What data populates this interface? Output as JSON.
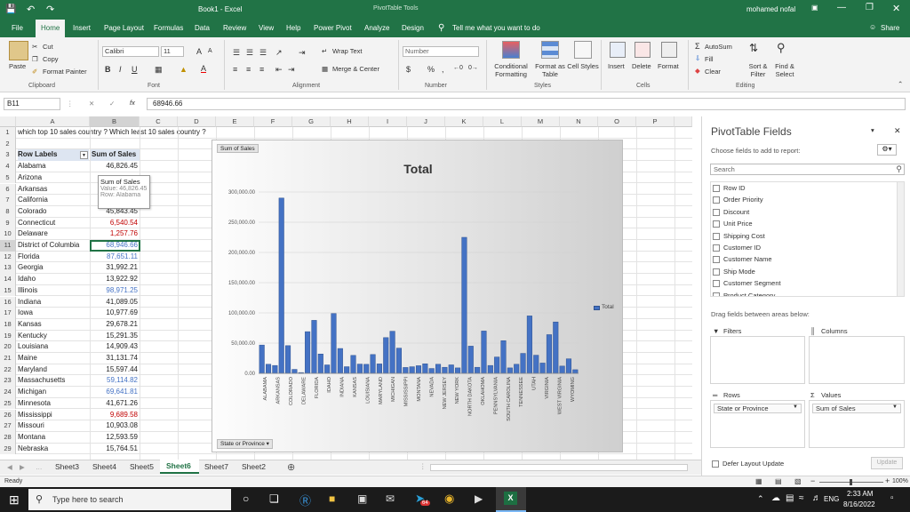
{
  "app": {
    "window_title": "Book1 - Excel",
    "contextual": "PivotTable Tools",
    "user": "mohamed nofal",
    "share": "Share"
  },
  "tabs": [
    "File",
    "Home",
    "Insert",
    "Page Layout",
    "Formulas",
    "Data",
    "Review",
    "View",
    "Help",
    "Power Pivot",
    "Analyze",
    "Design"
  ],
  "tell_me": "Tell me what you want to do",
  "ribbon": {
    "clipboard": {
      "paste": "Paste",
      "cut": "Cut",
      "copy": "Copy",
      "format_painter": "Format Painter",
      "label": "Clipboard"
    },
    "font": {
      "name": "Calibri",
      "size": "11",
      "bold": "B",
      "italic": "I",
      "underline": "U",
      "grow": "A",
      "shrink": "A",
      "label": "Font"
    },
    "alignment": {
      "wrap": "Wrap Text",
      "merge": "Merge & Center",
      "label": "Alignment"
    },
    "number": {
      "format": "Number",
      "currency": "$",
      "percent": "%",
      "comma": ",",
      "label": "Number"
    },
    "styles": {
      "cond": "Conditional Formatting",
      "table": "Format as Table",
      "cell": "Cell Styles",
      "label": "Styles"
    },
    "cells": {
      "insert": "Insert",
      "delete": "Delete",
      "format": "Format",
      "label": "Cells"
    },
    "editing": {
      "autosum": "AutoSum",
      "fill": "Fill",
      "clear": "Clear",
      "sort": "Sort & Filter",
      "find": "Find & Select",
      "label": "Editing"
    }
  },
  "formula_bar": {
    "name_box": "B11",
    "fx": "fx",
    "value": "68946.66"
  },
  "columns": [
    "A",
    "B",
    "C",
    "D",
    "E",
    "F",
    "G",
    "H",
    "I",
    "J",
    "K",
    "L",
    "M",
    "N",
    "O",
    "P"
  ],
  "question": "which top 10 sales country ? Which least 10 sales country ?",
  "pivot_headers": {
    "row_labels": "Row Labels",
    "sum": "Sum of Sales"
  },
  "rows": [
    {
      "n": "1"
    },
    {
      "n": "2"
    },
    {
      "n": "3",
      "a": "Row Labels",
      "b": "Sum of Sales"
    },
    {
      "n": "4",
      "a": "Alabama",
      "b": "46,826.45"
    },
    {
      "n": "5",
      "a": "Arizona",
      "b": ""
    },
    {
      "n": "6",
      "a": "Arkansas",
      "b": ""
    },
    {
      "n": "7",
      "a": "California",
      "b": ""
    },
    {
      "n": "8",
      "a": "Colorado",
      "b": "45,843.45"
    },
    {
      "n": "9",
      "a": "Connecticut",
      "b": "6,540.54",
      "c": "#c00000"
    },
    {
      "n": "10",
      "a": "Delaware",
      "b": "1,257.76",
      "c": "#c00000"
    },
    {
      "n": "11",
      "a": "District of Columbia",
      "b": "68,946.66",
      "c": "#4472c4"
    },
    {
      "n": "12",
      "a": "Florida",
      "b": "87,651.11",
      "c": "#4472c4"
    },
    {
      "n": "13",
      "a": "Georgia",
      "b": "31,992.21"
    },
    {
      "n": "14",
      "a": "Idaho",
      "b": "13,922.92"
    },
    {
      "n": "15",
      "a": "Illinois",
      "b": "98,971.25",
      "c": "#4472c4"
    },
    {
      "n": "16",
      "a": "Indiana",
      "b": "41,089.05"
    },
    {
      "n": "17",
      "a": "Iowa",
      "b": "10,977.69"
    },
    {
      "n": "18",
      "a": "Kansas",
      "b": "29,678.21"
    },
    {
      "n": "19",
      "a": "Kentucky",
      "b": "15,291.35"
    },
    {
      "n": "20",
      "a": "Louisiana",
      "b": "14,909.43"
    },
    {
      "n": "21",
      "a": "Maine",
      "b": "31,131.74"
    },
    {
      "n": "22",
      "a": "Maryland",
      "b": "15,597.44"
    },
    {
      "n": "23",
      "a": "Massachusetts",
      "b": "59,114.82",
      "c": "#4472c4"
    },
    {
      "n": "24",
      "a": "Michigan",
      "b": "69,641.81",
      "c": "#4472c4"
    },
    {
      "n": "25",
      "a": "Minnesota",
      "b": "41,671.26"
    },
    {
      "n": "26",
      "a": "Mississippi",
      "b": "9,689.58",
      "c": "#c00000"
    },
    {
      "n": "27",
      "a": "Missouri",
      "b": "10,903.08"
    },
    {
      "n": "28",
      "a": "Montana",
      "b": "12,593.59"
    },
    {
      "n": "29",
      "a": "Nebraska",
      "b": "15,764.51"
    }
  ],
  "tooltip": {
    "title": "Sum of Sales",
    "value": "Value: 46,826.45",
    "row": "Row: Alabama"
  },
  "chart_data": {
    "type": "bar",
    "title": "Total",
    "field_button": "Sum of Sales",
    "axis_button": "State or Province",
    "legend": "Total",
    "legend_position": "right",
    "ylim": [
      0,
      300000
    ],
    "yticks": [
      "0.00",
      "50,000.00",
      "100,000.00",
      "150,000.00",
      "200,000.00",
      "250,000.00",
      "300,000.00"
    ],
    "grid": true,
    "categories": [
      "ALABAMA",
      "ARKANSAS",
      "COLORADO",
      "DELAWARE",
      "FLORIDA",
      "IDAHO",
      "INDIANA",
      "KANSAS",
      "LOUISIANA",
      "MARYLAND",
      "MICHIGAN",
      "MISSISSIPPI",
      "MONTANA",
      "NEVADA",
      "NEW JERSEY",
      "NEW YORK",
      "NORTH DAKOTA",
      "OKLAHOMA",
      "PENNSYLVANIA",
      "SOUTH CAROLINA",
      "TENNESSEE",
      "UTAH",
      "VIRGINIA",
      "WEST VIRGINIA",
      "WYOMING"
    ],
    "values": [
      46826,
      15000,
      13000,
      290000,
      45843,
      6540,
      1257,
      68946,
      87651,
      31992,
      13922,
      98971,
      41089,
      10977,
      29678,
      15291,
      14909,
      31131,
      15597,
      59114,
      69641,
      41671,
      9689,
      10903,
      12593,
      15764,
      8000,
      15000,
      10000,
      14000,
      9000,
      225000,
      45000,
      10000,
      70000,
      13000,
      27000,
      54000,
      9000,
      15000,
      33000,
      95000,
      30000,
      17000,
      64000,
      85000,
      12000,
      24000,
      6000
    ]
  },
  "pane": {
    "title": "PivotTable Fields",
    "subtitle": "Choose fields to add to report:",
    "search_placeholder": "Search",
    "fields": [
      "Row ID",
      "Order Priority",
      "Discount",
      "Unit Price",
      "Shipping Cost",
      "Customer ID",
      "Customer Name",
      "Ship Mode",
      "Customer Segment",
      "Product Category"
    ],
    "drag_label": "Drag fields between areas below:",
    "filters": "Filters",
    "columns": "Columns",
    "rows_label": "Rows",
    "values_label": "Values",
    "rows_item": "State or Province",
    "values_item": "Sum of Sales",
    "defer": "Defer Layout Update",
    "update": "Update"
  },
  "sheets": [
    "Sheet3",
    "Sheet4",
    "Sheet5",
    "Sheet6",
    "Sheet7",
    "Sheet2"
  ],
  "active_sheet": "Sheet6",
  "status": {
    "ready": "Ready",
    "zoom": "100%"
  },
  "taskbar": {
    "search": "Type here to search",
    "lang": "ENG",
    "time": "2:33 AM",
    "date": "8/16/2022",
    "badge": "64"
  }
}
